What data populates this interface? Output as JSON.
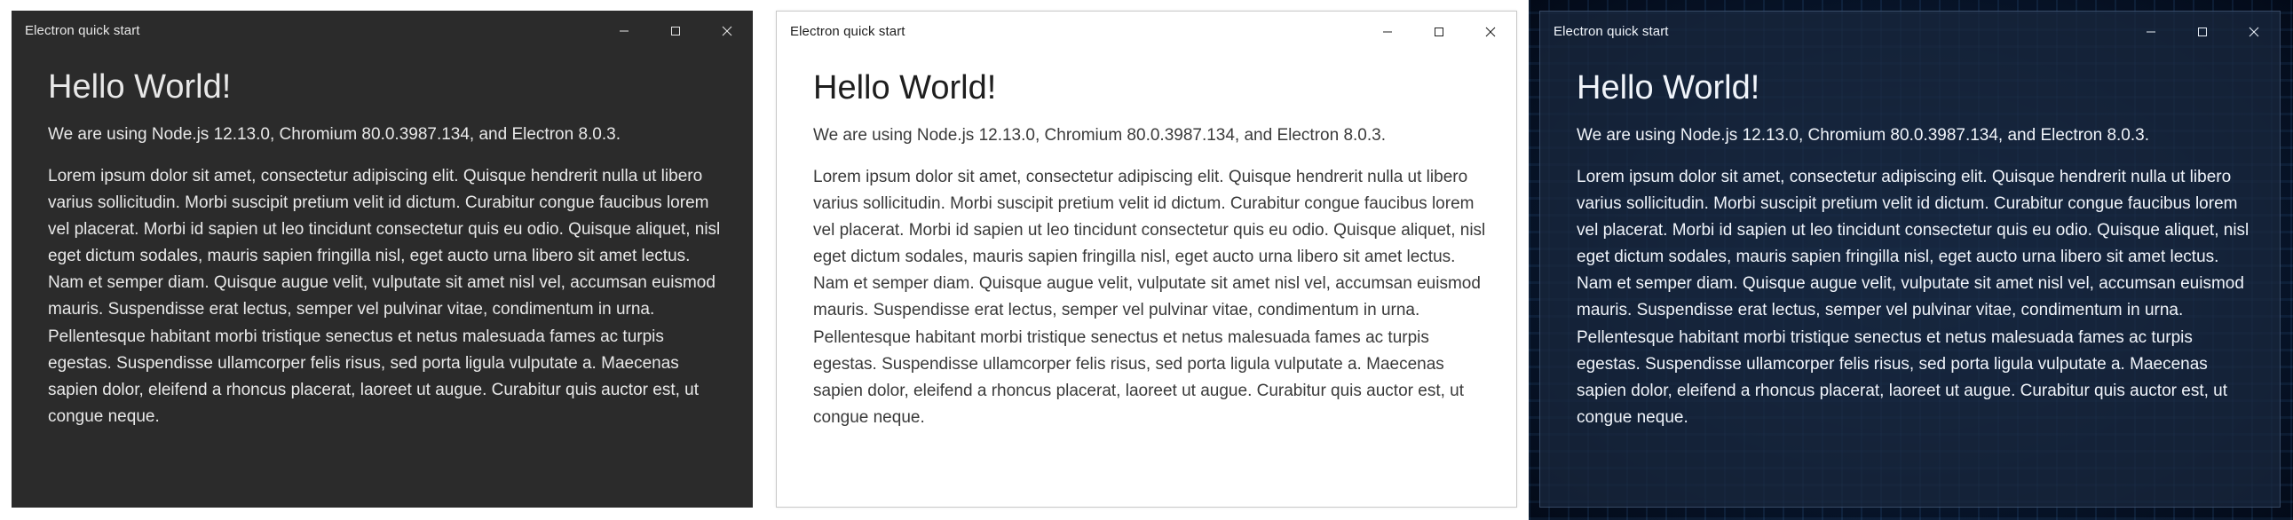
{
  "windows": [
    {
      "theme": "dark",
      "title": "Electron quick start",
      "heading": "Hello World!",
      "versions_text": "We are using Node.js 12.13.0, Chromium 80.0.3987.134, and Electron 8.0.3.",
      "body_text": "Lorem ipsum dolor sit amet, consectetur adipiscing elit. Quisque hendrerit nulla ut libero varius sollicitudin. Morbi suscipit pretium velit id dictum. Curabitur congue faucibus lorem vel placerat. Morbi id sapien ut leo tincidunt consectetur quis eu odio. Quisque aliquet, nisl eget dictum sodales, mauris sapien fringilla nisl, eget aucto urna libero sit amet lectus. Nam et semper diam. Quisque augue velit, vulputate sit amet nisl vel, accumsan euismod mauris. Suspendisse erat lectus, semper vel pulvinar vitae, condimentum in urna. Pellentesque habitant morbi tristique senectus et netus malesuada fames ac turpis egestas. Suspendisse ullamcorper felis risus, sed porta ligula vulputate a. Maecenas sapien dolor, eleifend a rhoncus placerat, laoreet ut augue. Curabitur quis auctor est, ut congue neque.",
      "background": "#2b2b2b"
    },
    {
      "theme": "light",
      "title": "Electron quick start",
      "heading": "Hello World!",
      "versions_text": "We are using Node.js 12.13.0, Chromium 80.0.3987.134, and Electron 8.0.3.",
      "body_text": "Lorem ipsum dolor sit amet, consectetur adipiscing elit. Quisque hendrerit nulla ut libero varius sollicitudin. Morbi suscipit pretium velit id dictum. Curabitur congue faucibus lorem vel placerat. Morbi id sapien ut leo tincidunt consectetur quis eu odio. Quisque aliquet, nisl eget dictum sodales, mauris sapien fringilla nisl, eget aucto urna libero sit amet lectus. Nam et semper diam. Quisque augue velit, vulputate sit amet nisl vel, accumsan euismod mauris. Suspendisse erat lectus, semper vel pulvinar vitae, condimentum in urna. Pellentesque habitant morbi tristique senectus et netus malesuada fames ac turpis egestas. Suspendisse ullamcorper felis risus, sed porta ligula vulputate a. Maecenas sapien dolor, eleifend a rhoncus placerat, laoreet ut augue. Curabitur quis auctor est, ut congue neque.",
      "background": "#ffffff"
    },
    {
      "theme": "acrylic",
      "title": "Electron quick start",
      "heading": "Hello World!",
      "versions_text": "We are using Node.js 12.13.0, Chromium 80.0.3987.134, and Electron 8.0.3.",
      "body_text": "Lorem ipsum dolor sit amet, consectetur adipiscing elit. Quisque hendrerit nulla ut libero varius sollicitudin. Morbi suscipit pretium velit id dictum. Curabitur congue faucibus lorem vel placerat. Morbi id sapien ut leo tincidunt consectetur quis eu odio. Quisque aliquet, nisl eget dictum sodales, mauris sapien fringilla nisl, eget aucto urna libero sit amet lectus. Nam et semper diam. Quisque augue velit, vulputate sit amet nisl vel, accumsan euismod mauris. Suspendisse erat lectus, semper vel pulvinar vitae, condimentum in urna. Pellentesque habitant morbi tristique senectus et netus malesuada fames ac turpis egestas. Suspendisse ullamcorper felis risus, sed porta ligula vulputate a. Maecenas sapien dolor, eleifend a rhoncus placerat, laoreet ut augue. Curabitur quis auctor est, ut congue neque.",
      "background": "#18263c"
    }
  ],
  "window_controls": {
    "minimize_icon": "minimize-icon",
    "maximize_icon": "maximize-icon",
    "close_icon": "close-icon"
  }
}
